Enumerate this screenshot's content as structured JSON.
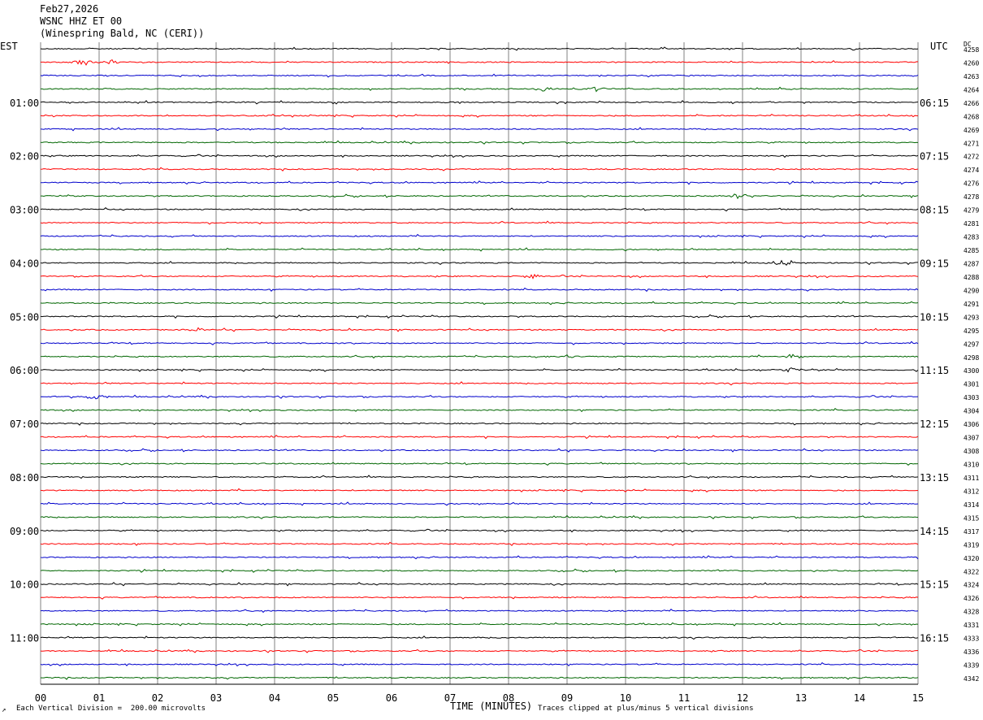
{
  "header": {
    "date": "Feb27,2026",
    "station": "WSNC HHZ ET 00",
    "location": "(Winespring Bald, NC (CERI))"
  },
  "left_zone": "EST",
  "right_zone": "UTC",
  "dc_label": "DC",
  "footer": {
    "xlabel": "TIME (MINUTES)",
    "scale_note": "Each Vertical Division =  200.00 microvolts",
    "clip_note": "Traces clipped at plus/minus 5 vertical divisions",
    "corner_mark": "↗"
  },
  "colors": {
    "cycle": [
      "#000000",
      "#ff0000",
      "#0000cc",
      "#006600"
    ],
    "grid": "#808080",
    "text": "#000000"
  },
  "chart_data": {
    "type": "line",
    "title": "",
    "xlabel": "TIME (MINUTES)",
    "ylabel": "",
    "x_range": [
      0,
      15
    ],
    "x_ticks": [
      "00",
      "01",
      "02",
      "03",
      "04",
      "05",
      "06",
      "07",
      "08",
      "09",
      "10",
      "11",
      "12",
      "13",
      "14",
      "15"
    ],
    "trace_count": 48,
    "left_hour_labels": [
      "01:00",
      "02:00",
      "03:00",
      "04:00",
      "05:00",
      "06:00",
      "07:00",
      "08:00",
      "09:00",
      "10:00",
      "11:00"
    ],
    "right_hour_labels": [
      "06:15",
      "07:15",
      "08:15",
      "09:15",
      "10:15",
      "11:15",
      "12:15",
      "13:15",
      "14:15",
      "15:15",
      "16:15"
    ],
    "dc_offsets": [
      4258,
      4260,
      4263,
      4264,
      4266,
      4268,
      4269,
      4271,
      4272,
      4274,
      4276,
      4278,
      4279,
      4281,
      4283,
      4285,
      4287,
      4288,
      4290,
      4291,
      4293,
      4295,
      4297,
      4298,
      4300,
      4301,
      4303,
      4304,
      4306,
      4307,
      4308,
      4310,
      4311,
      4312,
      4314,
      4315,
      4317,
      4319,
      4320,
      4322,
      4324,
      4326,
      4328,
      4331,
      4333,
      4336,
      4339,
      4342
    ],
    "events": [
      {
        "trace": 1,
        "minute": 0.75,
        "amp": 5
      },
      {
        "trace": 1,
        "minute": 1.2,
        "amp": 3
      },
      {
        "trace": 3,
        "minute": 8.6,
        "amp": 3
      },
      {
        "trace": 3,
        "minute": 9.5,
        "amp": 4
      },
      {
        "trace": 11,
        "minute": 11.9,
        "amp": 4
      },
      {
        "trace": 16,
        "minute": 12.7,
        "amp": 4
      },
      {
        "trace": 17,
        "minute": 8.4,
        "amp": 3
      },
      {
        "trace": 21,
        "minute": 2.7,
        "amp": 3
      },
      {
        "trace": 23,
        "minute": 9.0,
        "amp": 3
      },
      {
        "trace": 23,
        "minute": 12.85,
        "amp": 4
      },
      {
        "trace": 24,
        "minute": 12.8,
        "amp": 5
      },
      {
        "trace": 26,
        "minute": 0.9,
        "amp": 6
      }
    ],
    "grid": true
  }
}
